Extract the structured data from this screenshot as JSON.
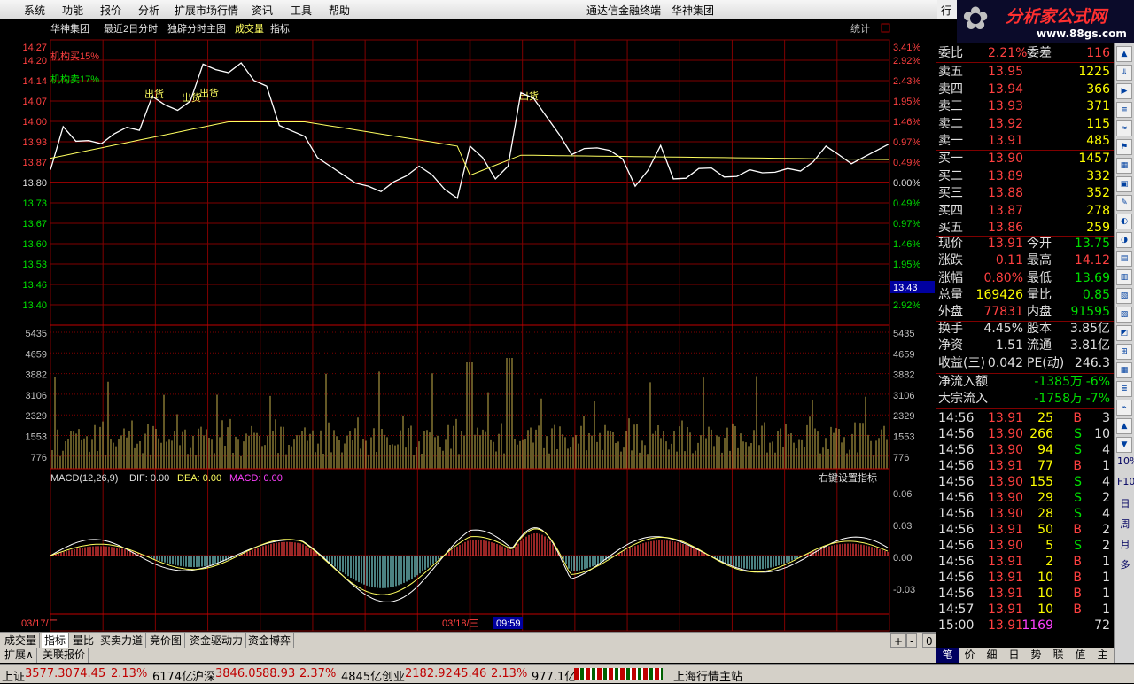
{
  "menu": {
    "items": [
      "系统",
      "功能",
      "报价",
      "分析",
      "扩展市场行情",
      "资讯",
      "工具",
      "帮助"
    ],
    "title": "通达信金融终端",
    "company": "华神集团",
    "hang": "行"
  },
  "logo": {
    "line1": "分析家公式网",
    "line2": "www.88gs.com"
  },
  "chart": {
    "header": {
      "name": "华神集团",
      "period": "最近2日分时",
      "mode": "独辟分时主图",
      "vol": "成交量",
      "ind": "指标",
      "stat": "统计"
    },
    "price_labels": [
      "14.27",
      "14.20",
      "14.14",
      "14.07",
      "14.00",
      "13.93",
      "13.87",
      "13.80",
      "13.73",
      "13.67",
      "13.60",
      "13.53",
      "13.46",
      "13.40"
    ],
    "pct_labels": [
      "3.41%",
      "2.92%",
      "2.43%",
      "1.95%",
      "1.46%",
      "0.97%",
      "0.49%",
      "0.00%",
      "0.49%",
      "0.97%",
      "1.46%",
      "1.95%",
      "2.43%",
      "2.92%"
    ],
    "annotations": {
      "inst_buy": "机构买15%",
      "inst_sell": "机构卖17%",
      "sell_mark": "出货"
    },
    "cursor_value": "13.43",
    "vol_labels": [
      "5435",
      "4659",
      "3882",
      "3106",
      "2329",
      "1553",
      "776"
    ],
    "macd": {
      "name": "MACD(12,26,9)",
      "dif_label": "DIF: 0.00",
      "dea_label": "DEA: 0.00",
      "macd_label": "MACD: 0.00",
      "setting": "右键设置指标",
      "labels": [
        "0.06",
        "0.03",
        "0.00",
        "-0.03"
      ]
    },
    "dates": {
      "d1": "03/17/二",
      "d2": "03/18/三",
      "cursor_time": "09:59"
    },
    "colors": {
      "up": "#ff4040",
      "down": "#00e000",
      "grid": "#800000",
      "price": "#ffffff",
      "avg": "#ffff60",
      "macd_up": "#ff4040",
      "macd_down": "#7fd8d8"
    }
  },
  "quote": {
    "ratio": {
      "l1": "委比",
      "v1": "2.21%",
      "l2": "委差",
      "v2": "116"
    },
    "sells": [
      {
        "label": "卖五",
        "price": "13.95",
        "vol": "1225"
      },
      {
        "label": "卖四",
        "price": "13.94",
        "vol": "366"
      },
      {
        "label": "卖三",
        "price": "13.93",
        "vol": "371"
      },
      {
        "label": "卖二",
        "price": "13.92",
        "vol": "115"
      },
      {
        "label": "卖一",
        "price": "13.91",
        "vol": "485"
      }
    ],
    "buys": [
      {
        "label": "买一",
        "price": "13.90",
        "vol": "1457"
      },
      {
        "label": "买二",
        "price": "13.89",
        "vol": "332"
      },
      {
        "label": "买三",
        "price": "13.88",
        "vol": "352"
      },
      {
        "label": "买四",
        "price": "13.87",
        "vol": "278"
      },
      {
        "label": "买五",
        "price": "13.86",
        "vol": "259"
      }
    ],
    "stats": [
      {
        "l1": "现价",
        "v1": "13.91",
        "c1": "#ff4040",
        "l2": "今开",
        "v2": "13.75",
        "c2": "#00e000"
      },
      {
        "l1": "涨跌",
        "v1": "0.11",
        "c1": "#ff4040",
        "l2": "最高",
        "v2": "14.12",
        "c2": "#ff4040"
      },
      {
        "l1": "涨幅",
        "v1": "0.80%",
        "c1": "#ff4040",
        "l2": "最低",
        "v2": "13.69",
        "c2": "#00e000"
      },
      {
        "l1": "总量",
        "v1": "169426",
        "c1": "#ffff00",
        "l2": "量比",
        "v2": "0.85",
        "c2": "#00e000"
      },
      {
        "l1": "外盘",
        "v1": "77831",
        "c1": "#ff4040",
        "l2": "内盘",
        "v2": "91595",
        "c2": "#00e000"
      }
    ],
    "fin": [
      {
        "l1": "换手",
        "v1": "4.45%",
        "l2": "股本",
        "v2": "3.85亿"
      },
      {
        "l1": "净资",
        "v1": "1.51",
        "l2": "流通",
        "v2": "3.81亿"
      },
      {
        "l1": "收益(三)",
        "v1": "0.042",
        "l2": "PE(动)",
        "v2": "246.3"
      }
    ],
    "flow": [
      {
        "label": "净流入额",
        "val": "-1385万",
        "pct": "-6%"
      },
      {
        "label": "大宗流入",
        "val": "-1758万",
        "pct": "-7%"
      }
    ],
    "ticks": [
      {
        "t": "14:56",
        "p": "13.91",
        "pc": "#ff4040",
        "v": "25",
        "bs": "B",
        "n": "3"
      },
      {
        "t": "14:56",
        "p": "13.90",
        "pc": "#ff4040",
        "v": "266",
        "bs": "S",
        "n": "10"
      },
      {
        "t": "14:56",
        "p": "13.90",
        "pc": "#ff4040",
        "v": "94",
        "bs": "S",
        "n": "4"
      },
      {
        "t": "14:56",
        "p": "13.91",
        "pc": "#ff4040",
        "v": "77",
        "bs": "B",
        "n": "1"
      },
      {
        "t": "14:56",
        "p": "13.90",
        "pc": "#ff4040",
        "v": "155",
        "bs": "S",
        "n": "4"
      },
      {
        "t": "14:56",
        "p": "13.90",
        "pc": "#ff4040",
        "v": "29",
        "bs": "S",
        "n": "2"
      },
      {
        "t": "14:56",
        "p": "13.90",
        "pc": "#ff4040",
        "v": "28",
        "bs": "S",
        "n": "4"
      },
      {
        "t": "14:56",
        "p": "13.91",
        "pc": "#ff4040",
        "v": "50",
        "bs": "B",
        "n": "2"
      },
      {
        "t": "14:56",
        "p": "13.90",
        "pc": "#ff4040",
        "v": "5",
        "bs": "S",
        "n": "2"
      },
      {
        "t": "14:56",
        "p": "13.91",
        "pc": "#ff4040",
        "v": "2",
        "bs": "B",
        "n": "1"
      },
      {
        "t": "14:56",
        "p": "13.91",
        "pc": "#ff4040",
        "v": "10",
        "bs": "B",
        "n": "1"
      },
      {
        "t": "14:56",
        "p": "13.91",
        "pc": "#ff4040",
        "v": "10",
        "bs": "B",
        "n": "1"
      },
      {
        "t": "14:57",
        "p": "13.91",
        "pc": "#ff4040",
        "v": "10",
        "bs": "B",
        "n": "1"
      },
      {
        "t": "15:00",
        "p": "13.91",
        "pc": "#ff4040",
        "v": "1169",
        "bs": "",
        "n": "72"
      }
    ],
    "tabs": [
      "笔",
      "价",
      "细",
      "日",
      "势",
      "联",
      "值",
      "主"
    ]
  },
  "bottom_tabs": [
    "成交量",
    "指标",
    "量比",
    "买卖力道",
    "竞价图",
    "资金驱动力",
    "资金博弈"
  ],
  "bottom_tabs2": [
    "扩展∧",
    "关联报价"
  ],
  "tabs_right": [
    "+",
    "-",
    "0"
  ],
  "status": {
    "sh_label": "上证",
    "sh_val": "3577.30",
    "sh_chg": "74.45",
    "sh_pct": "2.13%",
    "sh_amt": "6174亿",
    "sz_label": "沪深",
    "sz_val": "3846.05",
    "sz_chg": "88.93",
    "sz_pct": "2.37%",
    "sz_amt": "4845亿",
    "cy_label": "创业",
    "cy_val": "2182.92",
    "cy_chg": "45.46",
    "cy_pct": "2.13%",
    "cy_amt": "977.1亿",
    "station": "上海行情主站"
  },
  "rtool_chars": [
    "10%",
    "F10",
    "日",
    "周",
    "月",
    "多"
  ]
}
